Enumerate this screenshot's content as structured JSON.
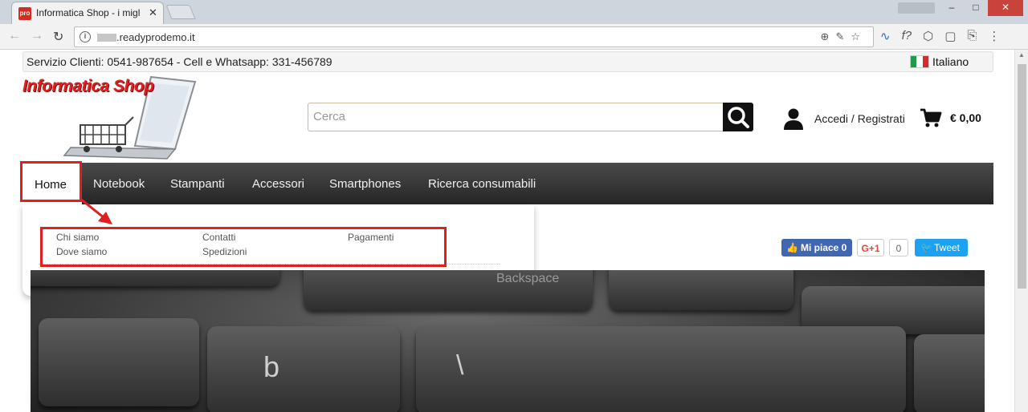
{
  "browser": {
    "tab_title": "Informatica Shop - i migl",
    "tab_favicon_text": "pro",
    "tab_close": "✕",
    "url": ".readyprodemo.it",
    "window_buttons": [
      "–",
      "□",
      "✕"
    ]
  },
  "topbar": {
    "contact": "Servizio Clienti: 0541-987654 - Cell e Whatsapp: 331-456789",
    "language": "Italiano"
  },
  "logo": {
    "brand": "Informatica Shop"
  },
  "search": {
    "placeholder": "Cerca"
  },
  "account": {
    "label": "Accedi / Registrati"
  },
  "cart": {
    "amount": "€ 0,00"
  },
  "nav": {
    "items": [
      "Home",
      "Notebook",
      "Stampanti",
      "Accessori",
      "Smartphones",
      "Ricerca consumabili"
    ]
  },
  "dropdown": {
    "links": [
      "Chi siamo",
      "Contatti",
      "Pagamenti",
      "Dove siamo",
      "Spedizioni"
    ]
  },
  "social": {
    "facebook": "Mi piace 0",
    "gplus": "G+1",
    "gplus_count": "0",
    "tweet": "Tweet"
  },
  "hero": {
    "key_labels": [
      "Backspace",
      "b",
      "\\"
    ]
  },
  "colors": {
    "highlight": "#e02020",
    "nav_bg": "#333333",
    "facebook": "#4267b2",
    "twitter": "#1da1f2"
  }
}
